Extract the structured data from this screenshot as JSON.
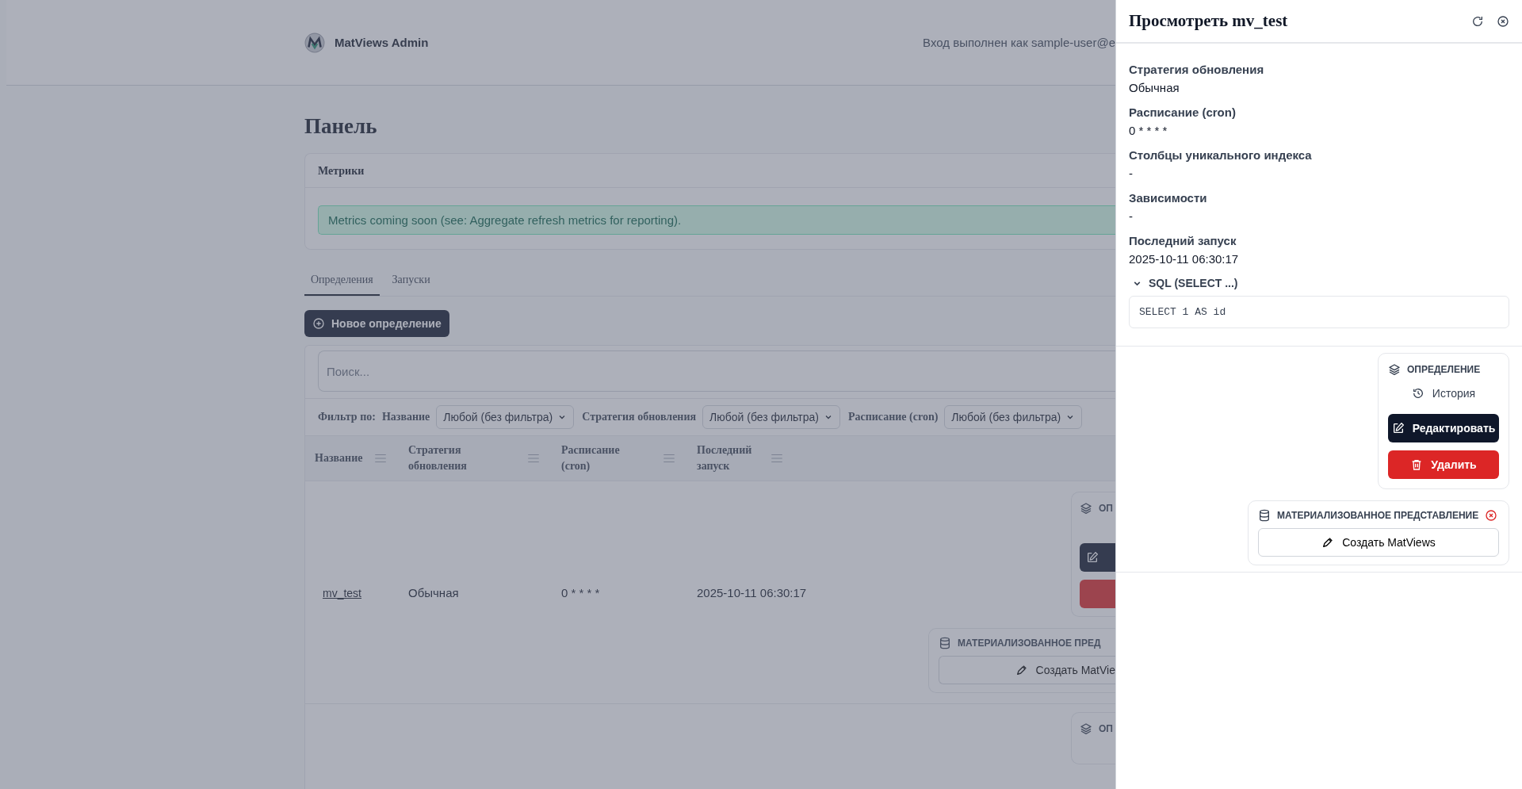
{
  "header": {
    "app_name": "MatViews Admin",
    "login_text": "Вход выполнен как sample-user@e"
  },
  "page_title": "Панель",
  "metrics": {
    "title": "Метрики",
    "message": "Metrics coming soon (see: Aggregate refresh metrics for reporting)."
  },
  "tabs": [
    {
      "label": "Определения",
      "selected": true
    },
    {
      "label": "Запуски",
      "selected": false
    }
  ],
  "new_button": "Новое определение",
  "search": {
    "placeholder": "Поиск..."
  },
  "filters": {
    "label": "Фильтр по:",
    "items": [
      {
        "label": "Название",
        "value": "Любой (без фильтра)"
      },
      {
        "label": "Стратегия обновления",
        "value": "Любой (без фильтра)"
      },
      {
        "label": "Расписание (cron)",
        "value": "Любой (без фильтра)"
      }
    ]
  },
  "table": {
    "columns": [
      "Название",
      "Стратегия обновления",
      "Расписание (cron)",
      "Последний запуск"
    ],
    "rows": [
      {
        "name": "mv_test",
        "strategy": "Обычная",
        "schedule": "0 * * * *",
        "last_run": "2025-10-11 06:30:17",
        "definition_title": "ОП",
        "matview_title": "МАТЕРИАЛИЗОВАННОЕ ПРЕД",
        "create_label": "Создать MatVie"
      },
      {
        "definition_title": "ОП"
      }
    ]
  },
  "drawer": {
    "title": "Просмотреть mv_test",
    "fields": [
      {
        "label": "Стратегия обновления",
        "value": "Обычная"
      },
      {
        "label": "Расписание (cron)",
        "value": "0 * * * *"
      },
      {
        "label": "Столбцы уникального индекса",
        "value": "-"
      },
      {
        "label": "Зависимости",
        "value": "-"
      },
      {
        "label": "Последний запуск",
        "value": "2025-10-11 06:30:17"
      }
    ],
    "sql": {
      "label": "SQL (SELECT ...)",
      "expanded": true,
      "code": "SELECT 1 AS id"
    },
    "definition": {
      "title": "ОПРЕДЕЛЕНИЕ",
      "history": "История",
      "edit": "Редактировать",
      "delete": "Удалить"
    },
    "matview": {
      "title": "МАТЕРИАЛИЗОВАННОЕ ПРЕДСТАВЛЕНИЕ",
      "exists": false,
      "create": "Создать MatViews"
    }
  }
}
